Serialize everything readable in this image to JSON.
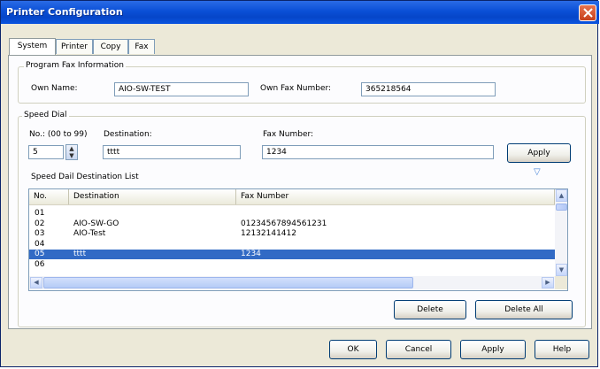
{
  "window": {
    "title": "Printer Configuration"
  },
  "tabs": [
    {
      "label": "System"
    },
    {
      "label": "Printer"
    },
    {
      "label": "Copy"
    },
    {
      "label": "Fax"
    }
  ],
  "program_fax_info": {
    "legend": "Program Fax Information",
    "own_name_label": "Own Name:",
    "own_name_value": "AIO-SW-TEST",
    "own_fax_number_label": "Own Fax Number:",
    "own_fax_number_value": "365218564"
  },
  "speed_dial": {
    "legend": "Speed Dial",
    "no_label": "No.: (00 to 99)",
    "no_value": "5",
    "destination_label": "Destination:",
    "destination_value": "tttt",
    "fax_number_label": "Fax Number:",
    "fax_number_value": "1234",
    "apply_label": "Apply",
    "list_label": "Speed Dail Destination List",
    "columns": [
      "No.",
      "Destination",
      "Fax Number"
    ],
    "rows": [
      {
        "no": "01",
        "destination": "",
        "fax": ""
      },
      {
        "no": "02",
        "destination": "AIO-SW-GO",
        "fax": "01234567894561231"
      },
      {
        "no": "03",
        "destination": "AIO-Test",
        "fax": "12132141412"
      },
      {
        "no": "04",
        "destination": "",
        "fax": ""
      },
      {
        "no": "05",
        "destination": "tttt",
        "fax": "1234"
      },
      {
        "no": "06",
        "destination": "",
        "fax": ""
      }
    ],
    "selected_row": "05",
    "delete_label": "Delete",
    "delete_all_label": "Delete All"
  },
  "footer": {
    "ok_label": "OK",
    "cancel_label": "Cancel",
    "apply_label": "Apply",
    "help_label": "Help"
  },
  "colors": {
    "title_bar": "#0a4fd6",
    "selection": "#316ac5",
    "close_button": "#d4532e"
  }
}
